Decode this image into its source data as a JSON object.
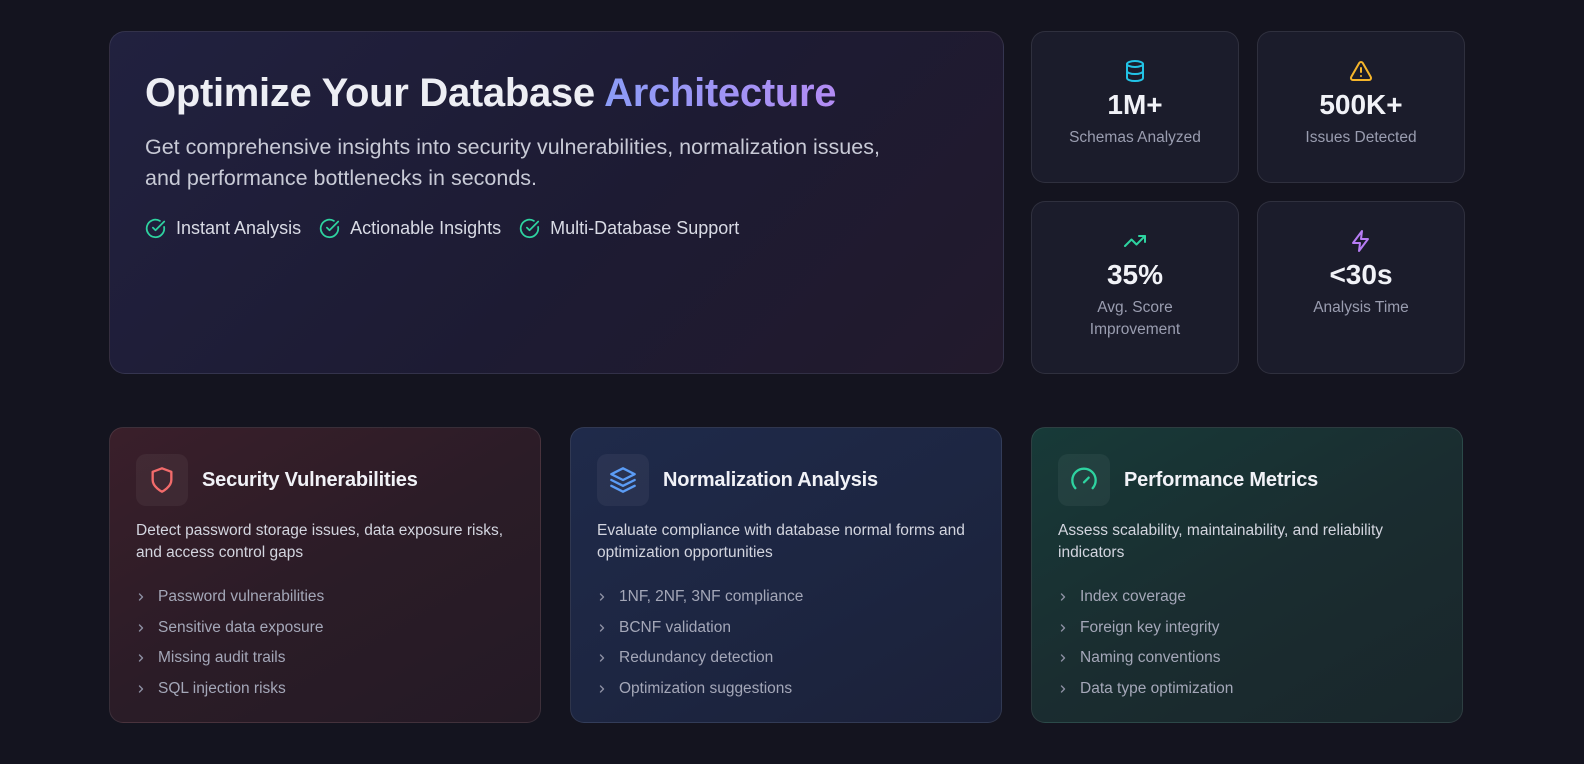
{
  "hero": {
    "title_main": "Optimize Your Database ",
    "title_accent": "Architecture",
    "subtitle": "Get comprehensive insights into security vulnerabilities, normalization issues, and performance bottlenecks in seconds.",
    "features": [
      {
        "label": "Instant Analysis",
        "icon": "check-circle-icon"
      },
      {
        "label": "Actionable Insights",
        "icon": "check-circle-icon"
      },
      {
        "label": "Multi-Database Support",
        "icon": "check-circle-icon"
      }
    ],
    "accent_gradient": [
      "#8b9cf6",
      "#b38cf4"
    ]
  },
  "stats": [
    {
      "value": "1M+",
      "label": "Schemas Analyzed",
      "icon": "database-icon",
      "color": "#22c3e6"
    },
    {
      "value": "500K+",
      "label": "Issues Detected",
      "icon": "warning-triangle-icon",
      "color": "#f5b52b"
    },
    {
      "value": "35%",
      "label": "Avg. Score Improvement",
      "icon": "trending-up-icon",
      "color": "#2ed3a0"
    },
    {
      "value": "<30s",
      "label": "Analysis Time",
      "icon": "lightning-bolt-icon",
      "color": "#b77cf5"
    }
  ],
  "cards": [
    {
      "title": "Security Vulnerabilities",
      "icon": "shield-icon",
      "color": "#f26b6b",
      "description": "Detect password storage issues, data exposure risks, and access control gaps",
      "items": [
        "Password vulnerabilities",
        "Sensitive data exposure",
        "Missing audit trails",
        "SQL injection risks"
      ]
    },
    {
      "title": "Normalization Analysis",
      "icon": "layers-icon",
      "color": "#5b9cf5",
      "description": "Evaluate compliance with database normal forms and optimization opportunities",
      "items": [
        "1NF, 2NF, 3NF compliance",
        "BCNF validation",
        "Redundancy detection",
        "Optimization suggestions"
      ]
    },
    {
      "title": "Performance Metrics",
      "icon": "gauge-icon",
      "color": "#2ed3a0",
      "description": "Assess scalability, maintainability, and reliability indicators",
      "items": [
        "Index coverage",
        "Foreign key integrity",
        "Naming conventions",
        "Data type optimization"
      ]
    }
  ],
  "check_color": "#2ed3a0"
}
